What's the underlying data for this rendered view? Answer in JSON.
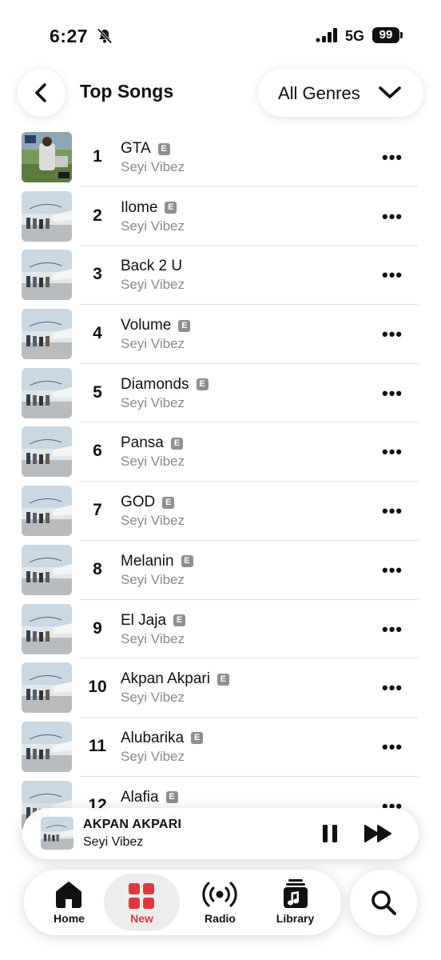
{
  "status": {
    "time": "6:27",
    "network": "5G",
    "battery": "99"
  },
  "header": {
    "back_icon": "chevron-left-icon",
    "title": "Top Songs",
    "genre_label": "All Genres",
    "genre_icon": "chevron-down-icon"
  },
  "explicit_badge": "E",
  "more_label": "•••",
  "songs": [
    {
      "rank": "1",
      "title": "GTA",
      "artist": "Seyi Vibez",
      "explicit": true
    },
    {
      "rank": "2",
      "title": "Ilome",
      "artist": "Seyi Vibez",
      "explicit": true
    },
    {
      "rank": "3",
      "title": "Back 2 U",
      "artist": "Seyi Vibez",
      "explicit": false
    },
    {
      "rank": "4",
      "title": "Volume",
      "artist": "Seyi Vibez",
      "explicit": true
    },
    {
      "rank": "5",
      "title": "Diamonds",
      "artist": "Seyi Vibez",
      "explicit": true
    },
    {
      "rank": "6",
      "title": "Pansa",
      "artist": "Seyi Vibez",
      "explicit": true
    },
    {
      "rank": "7",
      "title": "GOD",
      "artist": "Seyi Vibez",
      "explicit": true
    },
    {
      "rank": "8",
      "title": "Melanin",
      "artist": "Seyi Vibez",
      "explicit": true
    },
    {
      "rank": "9",
      "title": "El Jaja",
      "artist": "Seyi Vibez",
      "explicit": true
    },
    {
      "rank": "10",
      "title": "Akpan Akpari",
      "artist": "Seyi Vibez",
      "explicit": true
    },
    {
      "rank": "11",
      "title": "Alubarika",
      "artist": "Seyi Vibez",
      "explicit": true
    },
    {
      "rank": "12",
      "title": "Alafia",
      "artist": "Seyi Vibez",
      "explicit": true
    }
  ],
  "now_playing": {
    "title": "AKPAN AKPARI",
    "artist": "Seyi Vibez"
  },
  "tabs": [
    {
      "label": "Home",
      "icon": "home-icon",
      "active": false
    },
    {
      "label": "New",
      "icon": "grid-icon",
      "active": true
    },
    {
      "label": "Radio",
      "icon": "radio-icon",
      "active": false
    },
    {
      "label": "Library",
      "icon": "library-icon",
      "active": false
    }
  ],
  "search_icon": "search-icon",
  "colors": {
    "accent": "#e0383e",
    "secondary_text": "#8a8a8e"
  }
}
